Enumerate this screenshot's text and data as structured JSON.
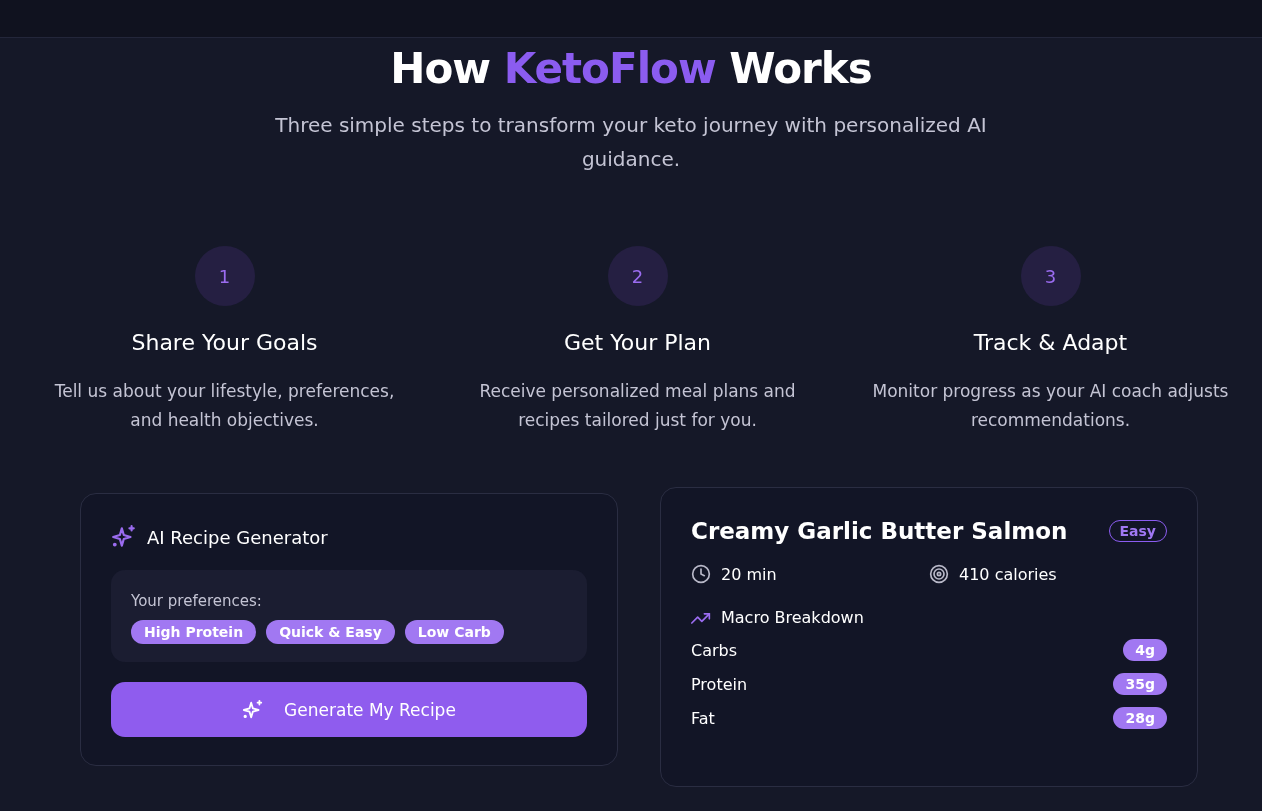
{
  "heading": {
    "parts": [
      {
        "text": "How ",
        "highlight": false
      },
      {
        "text": "KetoFlow",
        "highlight": true
      },
      {
        "text": " Works",
        "highlight": false
      }
    ]
  },
  "subtitle": "Three simple steps to transform your keto journey with personalized AI guidance.",
  "steps": [
    {
      "number": "1",
      "title": "Share Your Goals",
      "text": "Tell us about your lifestyle, preferences, and health objectives."
    },
    {
      "number": "2",
      "title": "Get Your Plan",
      "text": "Receive personalized meal plans and recipes tailored just for you."
    },
    {
      "number": "3",
      "title": "Track & Adapt",
      "text": "Monitor progress as your AI coach adjusts recommendations."
    }
  ],
  "generator": {
    "title": "AI Recipe Generator",
    "preferences_label": "Your preferences:",
    "tags": [
      "High Protein",
      "Quick & Easy",
      "Low Carb"
    ],
    "button": "Generate My Recipe"
  },
  "recipe": {
    "title": "Creamy Garlic Butter Salmon",
    "difficulty": "Easy",
    "time": "20 min",
    "calories": "410 calories",
    "macro_title": "Macro Breakdown",
    "macros": [
      {
        "name": "Carbs",
        "amount": "4g"
      },
      {
        "name": "Protein",
        "amount": "35g"
      },
      {
        "name": "Fat",
        "amount": "28g"
      }
    ]
  }
}
